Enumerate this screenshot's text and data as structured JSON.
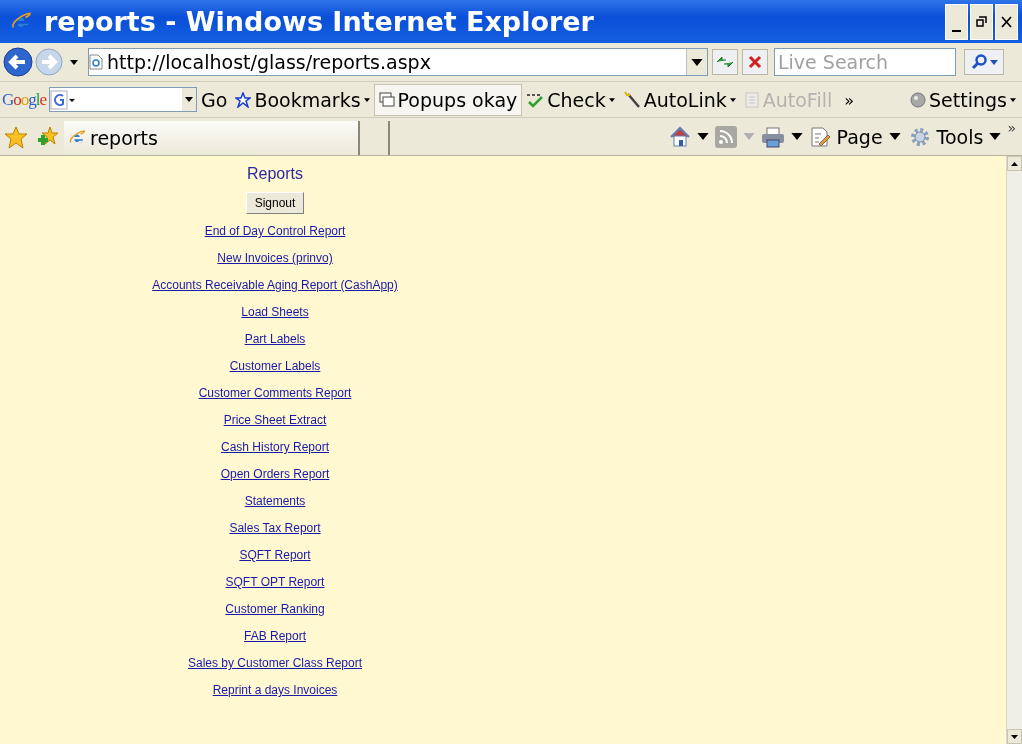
{
  "window": {
    "title": "reports - Windows Internet Explorer"
  },
  "address_bar": {
    "url": "http://localhost/glass/reports.aspx"
  },
  "search": {
    "placeholder": "Live Search"
  },
  "google_toolbar": {
    "logo": "Google",
    "go": "Go",
    "items": [
      {
        "kind": "button",
        "label": "Bookmarks",
        "disabled": false
      },
      {
        "kind": "toggle",
        "label": "Popups okay",
        "disabled": false
      },
      {
        "kind": "button",
        "label": "Check",
        "disabled": false
      },
      {
        "kind": "button",
        "label": "AutoLink",
        "disabled": false
      },
      {
        "kind": "button",
        "label": "AutoFill",
        "disabled": true
      },
      {
        "kind": "more",
        "label": "»",
        "disabled": false
      },
      {
        "kind": "button",
        "label": "Settings",
        "disabled": false
      }
    ]
  },
  "tabs": [
    {
      "label": "reports",
      "selected": true
    }
  ],
  "command_bar": {
    "items": [
      {
        "label": "Page"
      },
      {
        "label": "Tools"
      }
    ],
    "more": "»"
  },
  "page": {
    "title": "Reports",
    "signout": "Signout",
    "links": [
      "End of Day Control Report",
      "New Invoices (prinvo)",
      "Accounts Receivable Aging Report (CashApp)",
      "Load Sheets",
      "Part Labels",
      "Customer Labels",
      "Customer Comments Report",
      "Price Sheet Extract",
      "Cash History Report",
      "Open Orders Report",
      "Statements",
      "Sales Tax Report",
      "SQFT Report",
      "SQFT OPT Report",
      "Customer Ranking",
      "FAB Report",
      "Sales by Customer Class Report",
      "Reprint a days Invoices"
    ]
  }
}
